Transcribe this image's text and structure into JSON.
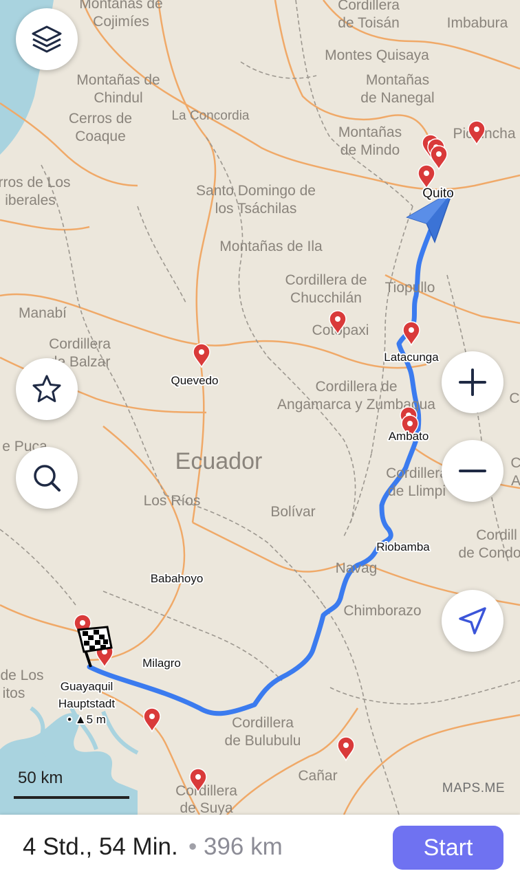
{
  "map": {
    "labels": [
      {
        "text": "Montañas de",
        "size": 21
      },
      {
        "text": "Cojimíes",
        "size": 21
      },
      {
        "text": "Cordillera",
        "size": 21
      },
      {
        "text": "de Toisán",
        "size": 21
      },
      {
        "text": "Imbabura",
        "size": 21
      },
      {
        "text": "Montes Quisaya",
        "size": 21
      },
      {
        "text": "Montañas de",
        "size": 21
      },
      {
        "text": "Chindul",
        "size": 21
      },
      {
        "text": "Montañas",
        "size": 21
      },
      {
        "text": "de Nanegal",
        "size": 21
      },
      {
        "text": "Cerros de",
        "size": 21
      },
      {
        "text": "Coaque",
        "size": 21
      },
      {
        "text": "La Concordia",
        "size": 19
      },
      {
        "text": "Montañas",
        "size": 21
      },
      {
        "text": "de Mindo",
        "size": 21
      },
      {
        "text": "Pichincha",
        "size": 21
      },
      {
        "text": "rros de Los",
        "size": 21
      },
      {
        "text": "iberales",
        "size": 21
      },
      {
        "text": "Santo Domingo de",
        "size": 21
      },
      {
        "text": "los Tsáchilas",
        "size": 21
      },
      {
        "text": "Montañas de Ila",
        "size": 21
      },
      {
        "text": "Cordillera de",
        "size": 21
      },
      {
        "text": "Chucchilán",
        "size": 21
      },
      {
        "text": "Tiopullo",
        "size": 21
      },
      {
        "text": "Manabí",
        "size": 21
      },
      {
        "text": "Cotopaxi",
        "size": 21
      },
      {
        "text": "Cordillera",
        "size": 21
      },
      {
        "text": "de Balzar",
        "size": 21
      },
      {
        "text": "Cordillera de",
        "size": 21
      },
      {
        "text": "Angamarca y Zumbagua",
        "size": 21
      },
      {
        "text": "e Puca",
        "size": 21
      },
      {
        "text": "Ecuador",
        "size": 34
      },
      {
        "text": "Cordillera",
        "size": 21
      },
      {
        "text": "de Llimpi",
        "size": 21
      },
      {
        "text": "Los Ríos",
        "size": 21
      },
      {
        "text": "Bolívar",
        "size": 21
      },
      {
        "text": "Cordill",
        "size": 21
      },
      {
        "text": "de Condo",
        "size": 21
      },
      {
        "text": "Navag",
        "size": 21
      },
      {
        "text": "Chimborazo",
        "size": 21
      },
      {
        "text": "de Los",
        "size": 21
      },
      {
        "text": "itos",
        "size": 21
      },
      {
        "text": "Cordillera",
        "size": 21
      },
      {
        "text": "de Bulubulu",
        "size": 21
      },
      {
        "text": "Cañar",
        "size": 21
      },
      {
        "text": "Cordillera",
        "size": 21
      },
      {
        "text": "de Suya",
        "size": 21
      },
      {
        "text": "C",
        "size": 21
      },
      {
        "text": "C",
        "size": 21
      },
      {
        "text": "A",
        "size": 21
      }
    ],
    "cities": [
      {
        "text": "Quito"
      },
      {
        "text": "Latacunga"
      },
      {
        "text": "Quevedo"
      },
      {
        "text": "Ambato"
      },
      {
        "text": "Riobamba"
      },
      {
        "text": "Babahoyo"
      },
      {
        "text": "Milagro"
      },
      {
        "text": "Guayaquil"
      },
      {
        "text": "Hauptstadt"
      },
      {
        "text": "• ▲5 m"
      }
    ],
    "route_color": "#3b7bef",
    "pin_color": "#d93a3a",
    "scale_label": "50 km",
    "watermark": "MAPS.ME"
  },
  "controls": {
    "layers": "layers-icon",
    "bookmarks": "star-icon",
    "search": "search-icon",
    "zoom_in": "plus-icon",
    "zoom_out": "minus-icon",
    "my_position": "location-arrow-icon"
  },
  "route_panel": {
    "time": "4 Std., 54 Min.",
    "separator": "•",
    "distance": "396 km",
    "start_label": "Start"
  }
}
